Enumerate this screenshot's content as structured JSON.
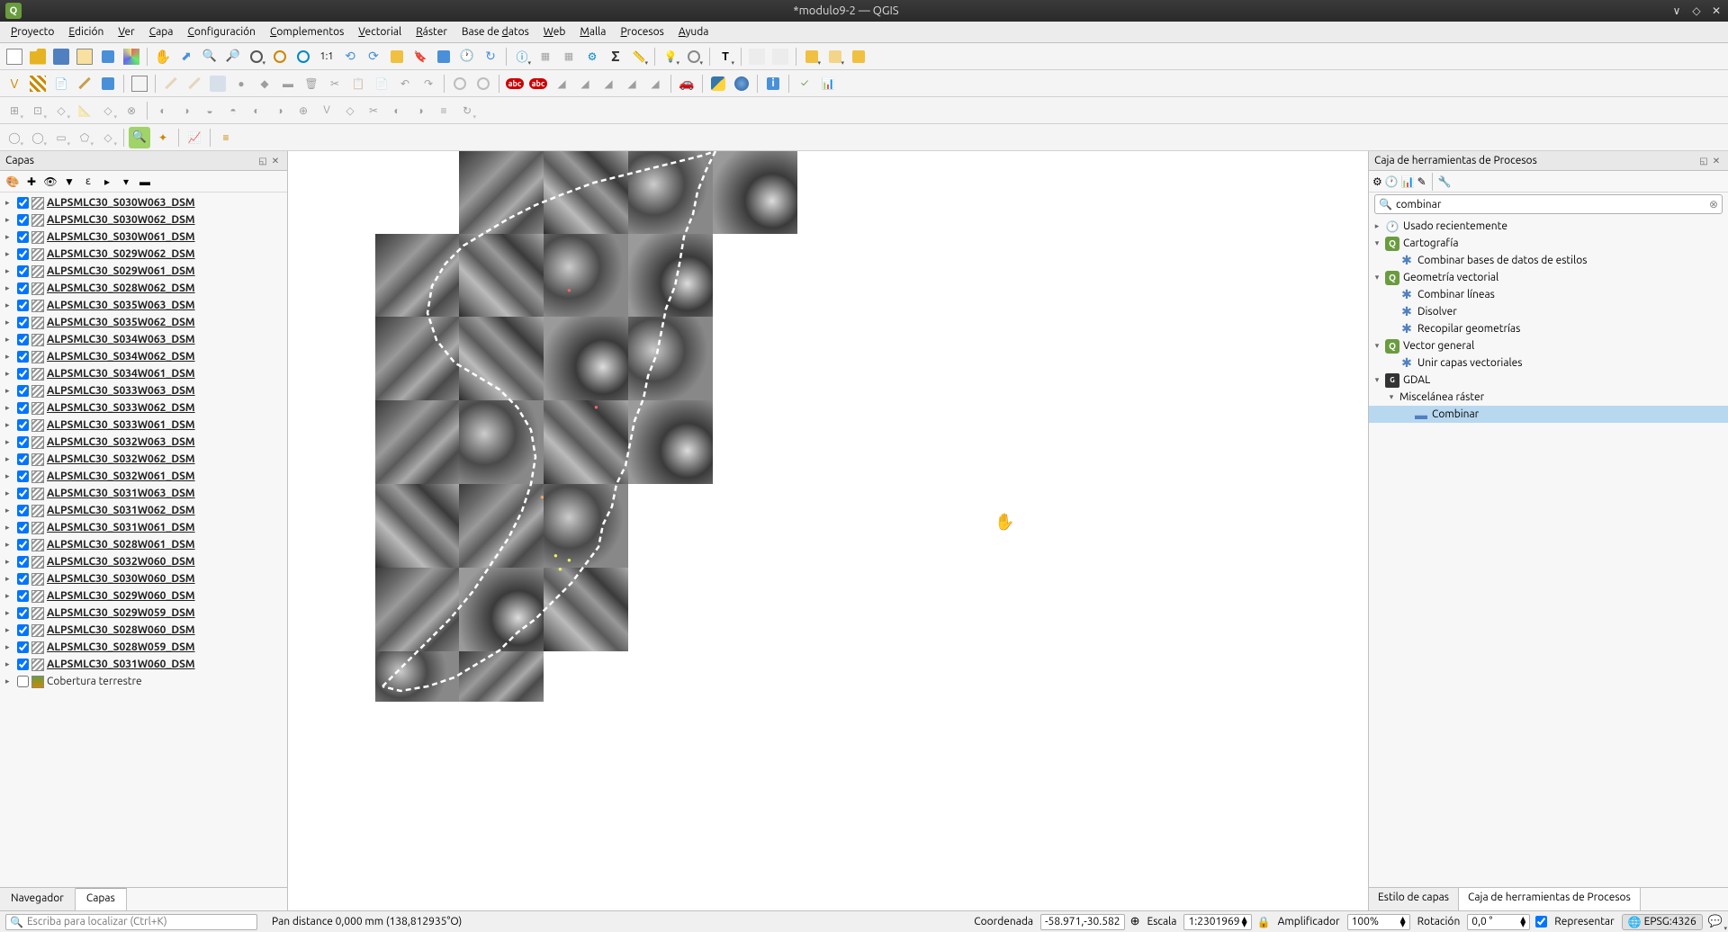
{
  "titlebar": {
    "logo_letter": "Q",
    "title": "*modulo9-2 — QGIS"
  },
  "menu": {
    "items": [
      "Proyecto",
      "Edición",
      "Ver",
      "Capa",
      "Configuración",
      "Complementos",
      "Vectorial",
      "Ráster",
      "Base de datos",
      "Web",
      "Malla",
      "Procesos",
      "Ayuda"
    ]
  },
  "layers_panel": {
    "title": "Capas",
    "tabs": [
      "Navegador",
      "Capas"
    ],
    "active_tab": "Capas",
    "layers": [
      "ALPSMLC30_S030W063_DSM",
      "ALPSMLC30_S030W062_DSM",
      "ALPSMLC30_S030W061_DSM",
      "ALPSMLC30_S029W062_DSM",
      "ALPSMLC30_S029W061_DSM",
      "ALPSMLC30_S028W062_DSM",
      "ALPSMLC30_S035W063_DSM",
      "ALPSMLC30_S035W062_DSM",
      "ALPSMLC30_S034W063_DSM",
      "ALPSMLC30_S034W062_DSM",
      "ALPSMLC30_S034W061_DSM",
      "ALPSMLC30_S033W063_DSM",
      "ALPSMLC30_S033W062_DSM",
      "ALPSMLC30_S033W061_DSM",
      "ALPSMLC30_S032W063_DSM",
      "ALPSMLC30_S032W062_DSM",
      "ALPSMLC30_S032W061_DSM",
      "ALPSMLC30_S031W063_DSM",
      "ALPSMLC30_S031W062_DSM",
      "ALPSMLC30_S031W061_DSM",
      "ALPSMLC30_S028W061_DSM",
      "ALPSMLC30_S032W060_DSM",
      "ALPSMLC30_S030W060_DSM",
      "ALPSMLC30_S029W060_DSM",
      "ALPSMLC30_S029W059_DSM",
      "ALPSMLC30_S028W060_DSM",
      "ALPSMLC30_S028W059_DSM",
      "ALPSMLC30_S031W060_DSM"
    ],
    "unchecked_layer": "Cobertura terrestre"
  },
  "processing_panel": {
    "title": "Caja de herramientas de Procesos",
    "search_value": "combinar",
    "tree": {
      "recent": "Usado recientemente",
      "groups": [
        {
          "name": "Cartografía",
          "algs": [
            "Combinar bases de datos de estilos"
          ]
        },
        {
          "name": "Geometría vectorial",
          "algs": [
            "Combinar líneas",
            "Disolver",
            "Recopilar geometrías"
          ]
        },
        {
          "name": "Vector general",
          "algs": [
            "Unir capas vectoriales"
          ]
        },
        {
          "name": "GDAL",
          "subgroups": [
            {
              "name": "Miscelánea ráster",
              "algs": [
                "Combinar"
              ]
            }
          ]
        }
      ],
      "selected": "Combinar"
    },
    "tabs": [
      "Estilo de capas",
      "Caja de herramientas de Procesos"
    ],
    "active_tab": "Caja de herramientas de Procesos"
  },
  "locator": {
    "placeholder": "Escriba para localizar (Ctrl+K)",
    "pan_msg": "Pan distance 0,000 mm (138,812935°O)"
  },
  "status": {
    "coord_label": "Coordenada",
    "coord_value": "-58.971,-30.582",
    "scale_label": "Escala",
    "scale_value": "1:2301969",
    "mag_label": "Amplificador",
    "mag_value": "100%",
    "rot_label": "Rotación",
    "rot_value": "0,0 °",
    "render_label": "Representar",
    "epsg": "EPSG:4326"
  }
}
